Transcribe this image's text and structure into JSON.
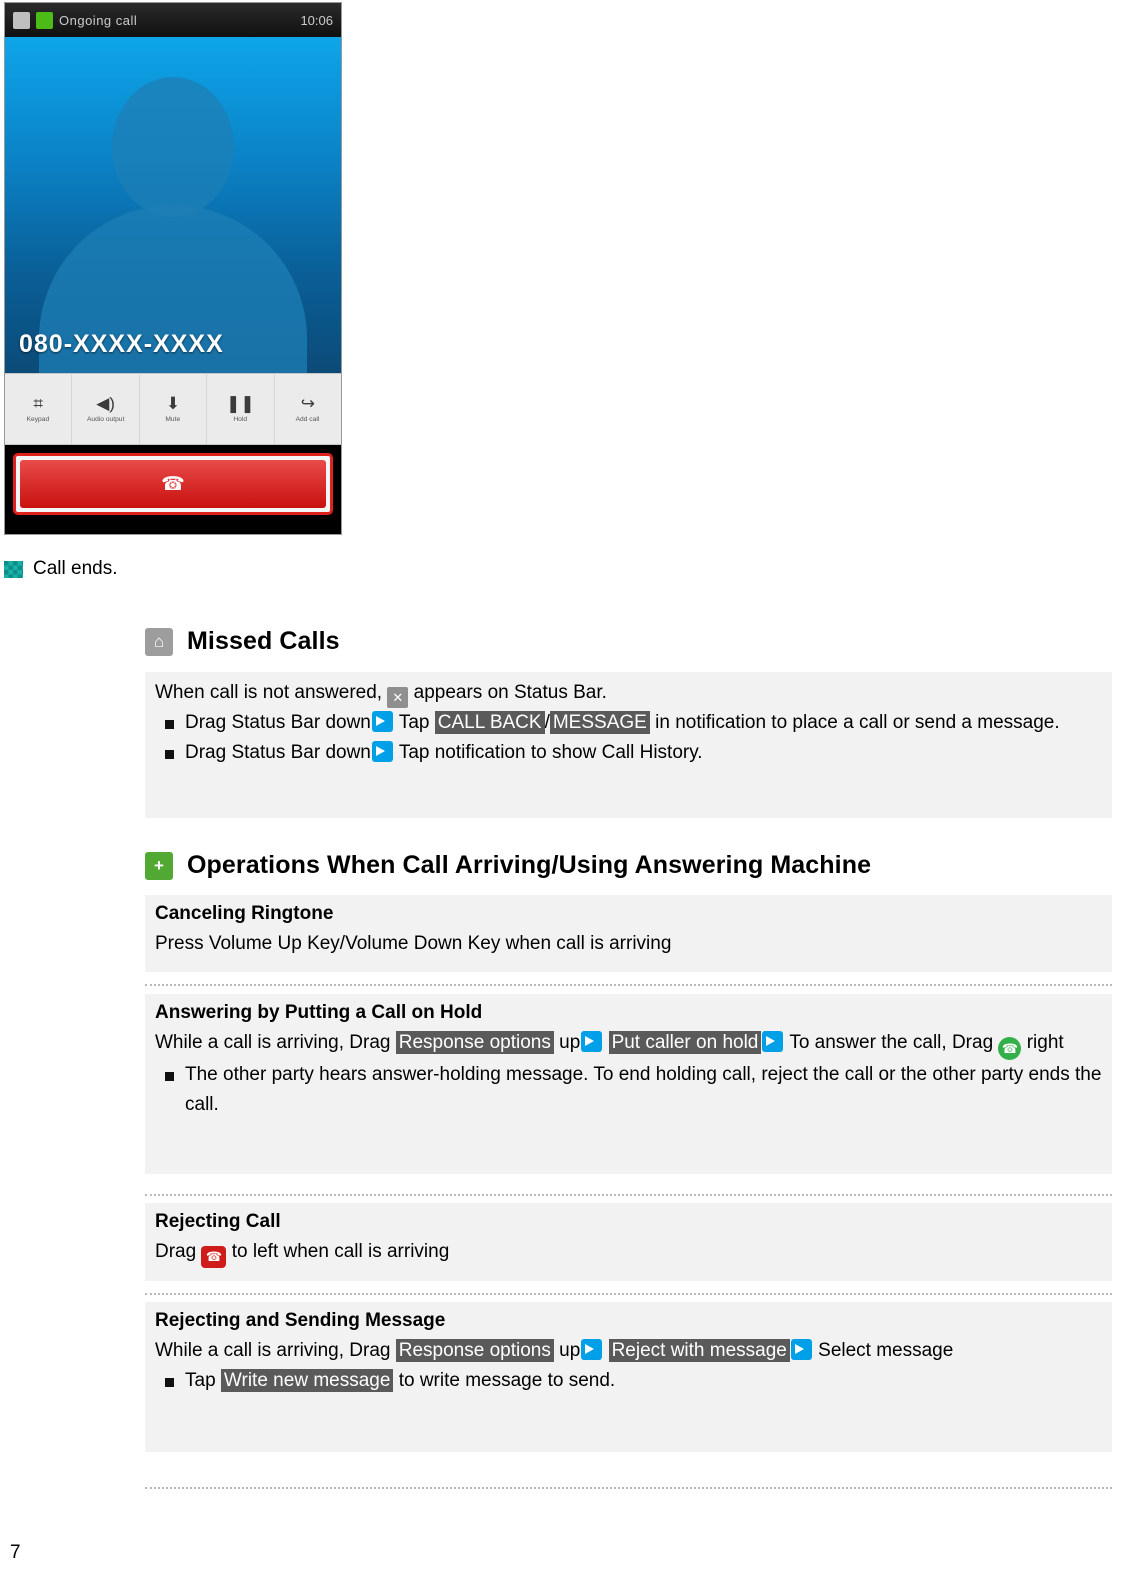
{
  "phone": {
    "status_title": "Ongoing call",
    "status_clock": "10:06",
    "number": "080-XXXX-XXXX",
    "actions": [
      {
        "label": "Keypad",
        "glyph": "⌗"
      },
      {
        "label": "Audio output",
        "glyph": "◀)"
      },
      {
        "label": "Mute",
        "glyph": "⬇"
      },
      {
        "label": "Hold",
        "glyph": "❚❚"
      },
      {
        "label": "Add call",
        "glyph": "↪"
      }
    ],
    "end_call_glyph": "☎"
  },
  "caption": {
    "call_ends": "Call ends."
  },
  "missed": {
    "badge": "⌂",
    "title": "Missed Calls",
    "intro_before": "When call is not answered,",
    "intro_icon": "✕",
    "intro_after": "appears on Status Bar.",
    "b1_a": "Drag Status Bar down",
    "b1_b": "Tap",
    "b1_hl1": "CALL BACK",
    "b1_sep": "/",
    "b1_hl2": "MESSAGE",
    "b1_c": "in notification to place a call or send a message.",
    "b2_a": "Drag Status Bar down",
    "b2_b": "Tap notification to show Call History."
  },
  "operations": {
    "badge": "+",
    "title": "Operations When Call Arriving/Using Answering Machine",
    "sections": [
      {
        "title": "Canceling Ringtone",
        "line": "Press Volume Up Key/Volume Down Key when call is arriving"
      },
      {
        "title": "Answering by Putting a Call on Hold",
        "l1_a": "While a call is arriving, Drag",
        "l1_hl1": "Response options",
        "l1_b": "up",
        "l1_hl2": "Put caller on hold",
        "l1_c": "To answer the call, Drag",
        "l1_d": "right",
        "bullet": "The other party hears answer-holding message. To end holding call, reject the call or the other party ends the call."
      },
      {
        "title": "Rejecting Call",
        "l1_a": "Drag",
        "l1_b": "to left when call is arriving"
      },
      {
        "title": "Rejecting and Sending Message",
        "l1_a": "While a call is arriving, Drag",
        "l1_hl1": "Response options",
        "l1_b": "up",
        "l1_hl2": "Reject with message",
        "l1_c": "Select message",
        "b1_a": "Tap",
        "b1_hl": "Write new message",
        "b1_b": "to write message to send."
      }
    ]
  },
  "footer": {
    "page": "7"
  }
}
